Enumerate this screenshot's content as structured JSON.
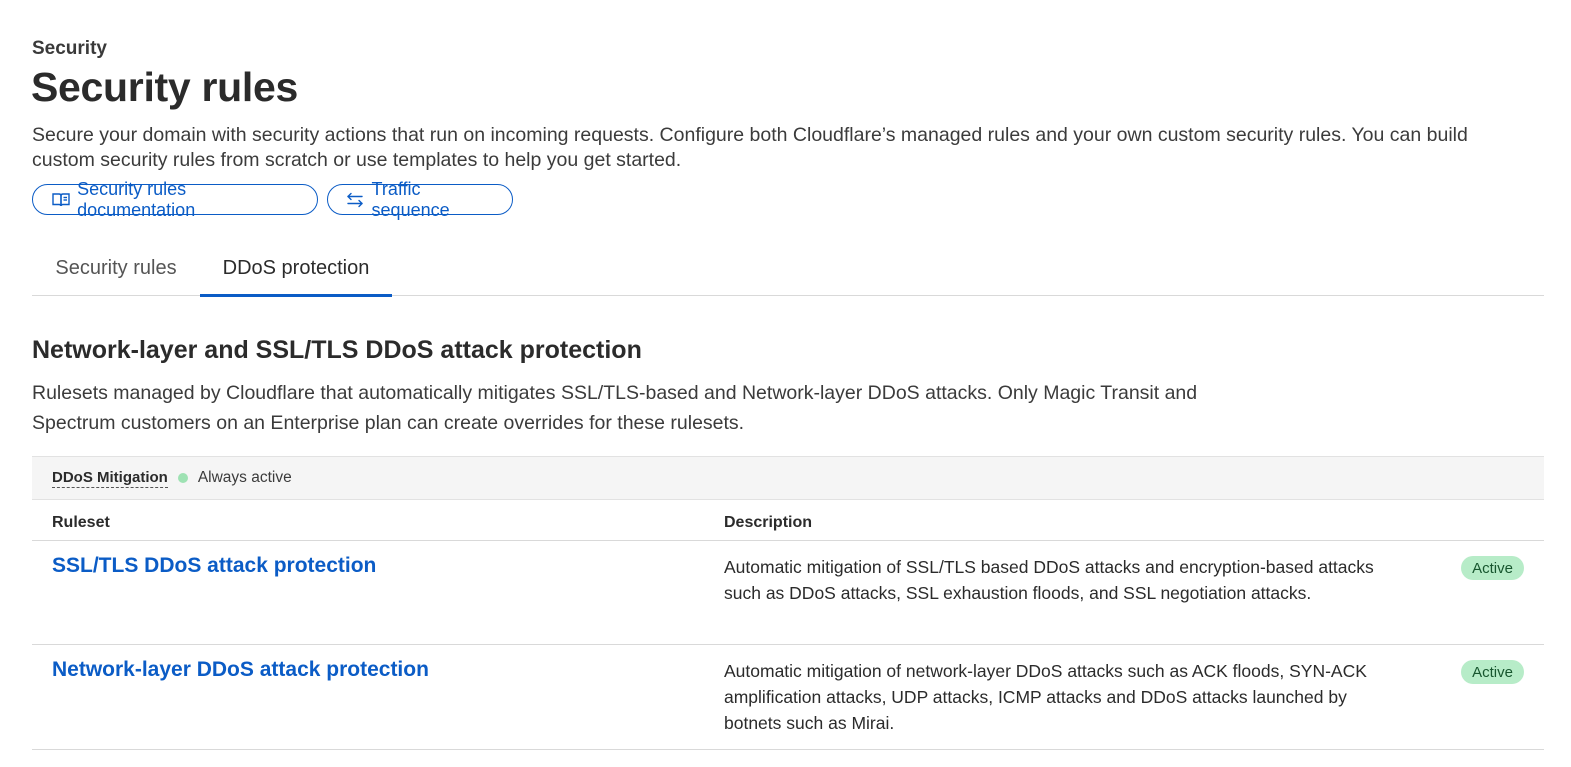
{
  "header": {
    "breadcrumb": "Security",
    "title": "Security rules",
    "description": "Secure your domain with security actions that run on incoming requests. Configure both Cloudflare’s managed rules and your own custom security rules. You can build custom security rules from scratch or use templates to help you get started."
  },
  "buttons": {
    "docs_label": "Security rules documentation",
    "docs_icon": "book-icon",
    "traffic_label": "Traffic sequence",
    "traffic_icon": "swap-arrows-icon"
  },
  "tabs": [
    {
      "label": "Security rules",
      "active": false
    },
    {
      "label": "DDoS protection",
      "active": true
    }
  ],
  "section": {
    "title": "Network-layer and SSL/TLS DDoS attack protection",
    "description": "Rulesets managed by Cloudflare that automatically mitigates SSL/TLS-based and Network-layer DDoS attacks. Only Magic Transit and Spectrum customers on an Enterprise plan can create overrides for these rulesets."
  },
  "status_bar": {
    "label": "DDoS Mitigation",
    "status": "Always active",
    "status_color": "#9ee2b3"
  },
  "table": {
    "columns": [
      "Ruleset",
      "Description"
    ],
    "rows": [
      {
        "ruleset": "SSL/TLS DDoS attack protection",
        "description": "Automatic mitigation of SSL/TLS based DDoS attacks and encryption-based attacks such as DDoS attacks, SSL exhaustion floods, and SSL negotiation attacks.",
        "status": "Active"
      },
      {
        "ruleset": "Network-layer DDoS attack protection",
        "description": "Automatic mitigation of network-layer DDoS attacks such as ACK floods, SYN-ACK amplification attacks, UDP attacks, ICMP attacks and DDoS attacks launched by botnets such as Mirai.",
        "status": "Active"
      }
    ]
  },
  "colors": {
    "accent": "#0b5cc6",
    "badge_bg": "#b7ecc8",
    "badge_text": "#17562e"
  }
}
